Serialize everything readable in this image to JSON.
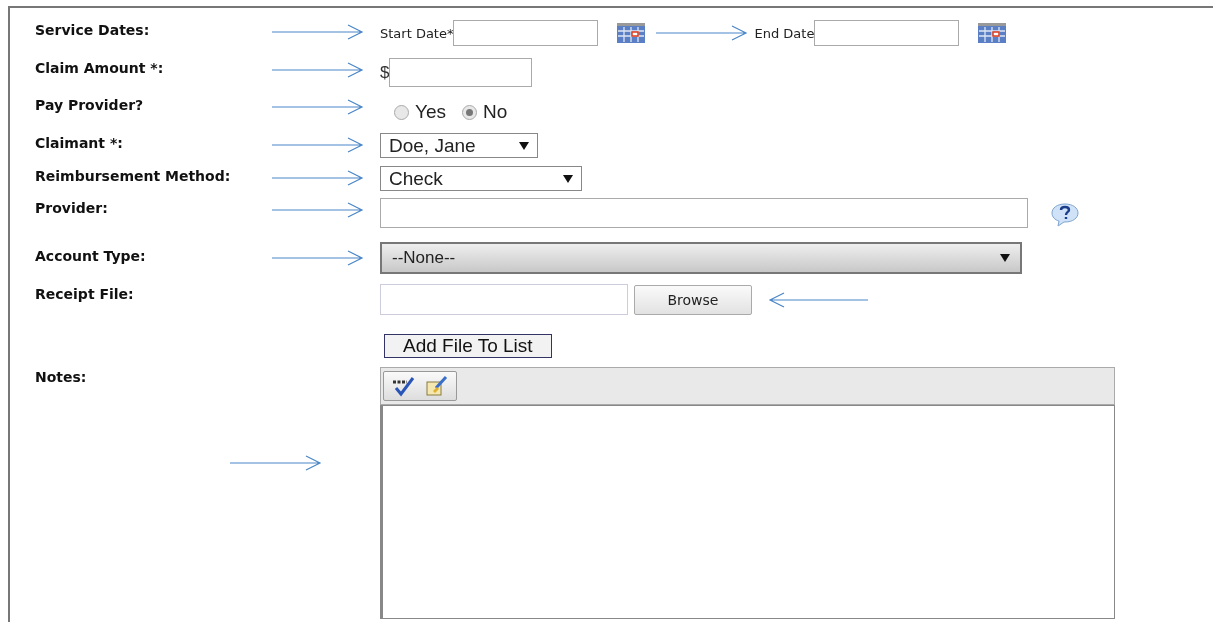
{
  "fields": [
    {
      "kind": "dates",
      "label": "Service Dates:",
      "start_label": "Start Date*",
      "end_label": "End Date",
      "arrow": true
    },
    {
      "kind": "amount",
      "label": "Claim Amount *:",
      "prefix": "$",
      "arrow": true
    },
    {
      "kind": "radio",
      "label": "Pay Provider?",
      "arrow": true,
      "options": [
        {
          "label": "Yes",
          "selected": false
        },
        {
          "label": "No",
          "selected": true
        }
      ]
    },
    {
      "kind": "select",
      "label": "Claimant *:",
      "value": "Doe, Jane",
      "arrow": true
    },
    {
      "kind": "select",
      "label": "Reimbursement Method:",
      "value": "Check",
      "arrow": true
    },
    {
      "kind": "text",
      "label": "Provider:",
      "arrow": true
    },
    {
      "kind": "wide-select",
      "label": "Account Type:",
      "value": "--None--",
      "arrow": true
    },
    {
      "kind": "file",
      "label": "Receipt File:",
      "button": "Browse",
      "arrow": true
    },
    {
      "kind": "button",
      "button": "Add File To List"
    },
    {
      "kind": "notes",
      "label": "Notes:",
      "arrow": true
    }
  ]
}
